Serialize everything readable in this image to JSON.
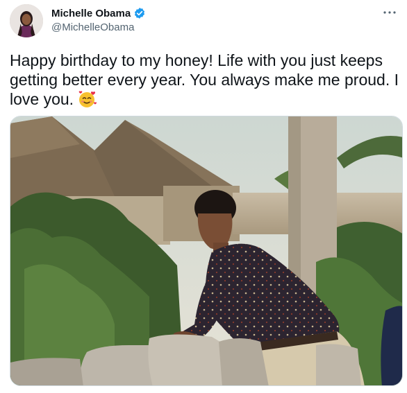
{
  "author": {
    "display_name": "Michelle Obama",
    "handle": "@MichelleObama",
    "verified": true,
    "verified_icon": "verified-badge-icon",
    "verified_color": "#1d9bf0"
  },
  "more_icon": "more-options-icon",
  "tweet": {
    "text": "Happy birthday to my honey! Life with you just keeps getting better every year. You always make me proud. I love you.",
    "emoji": "smiling-face-with-hearts-emoji"
  },
  "media": {
    "type": "photo",
    "alt": "Photo of a young man leaning on a stone wall in front of thatched-roof buildings and greenery"
  }
}
